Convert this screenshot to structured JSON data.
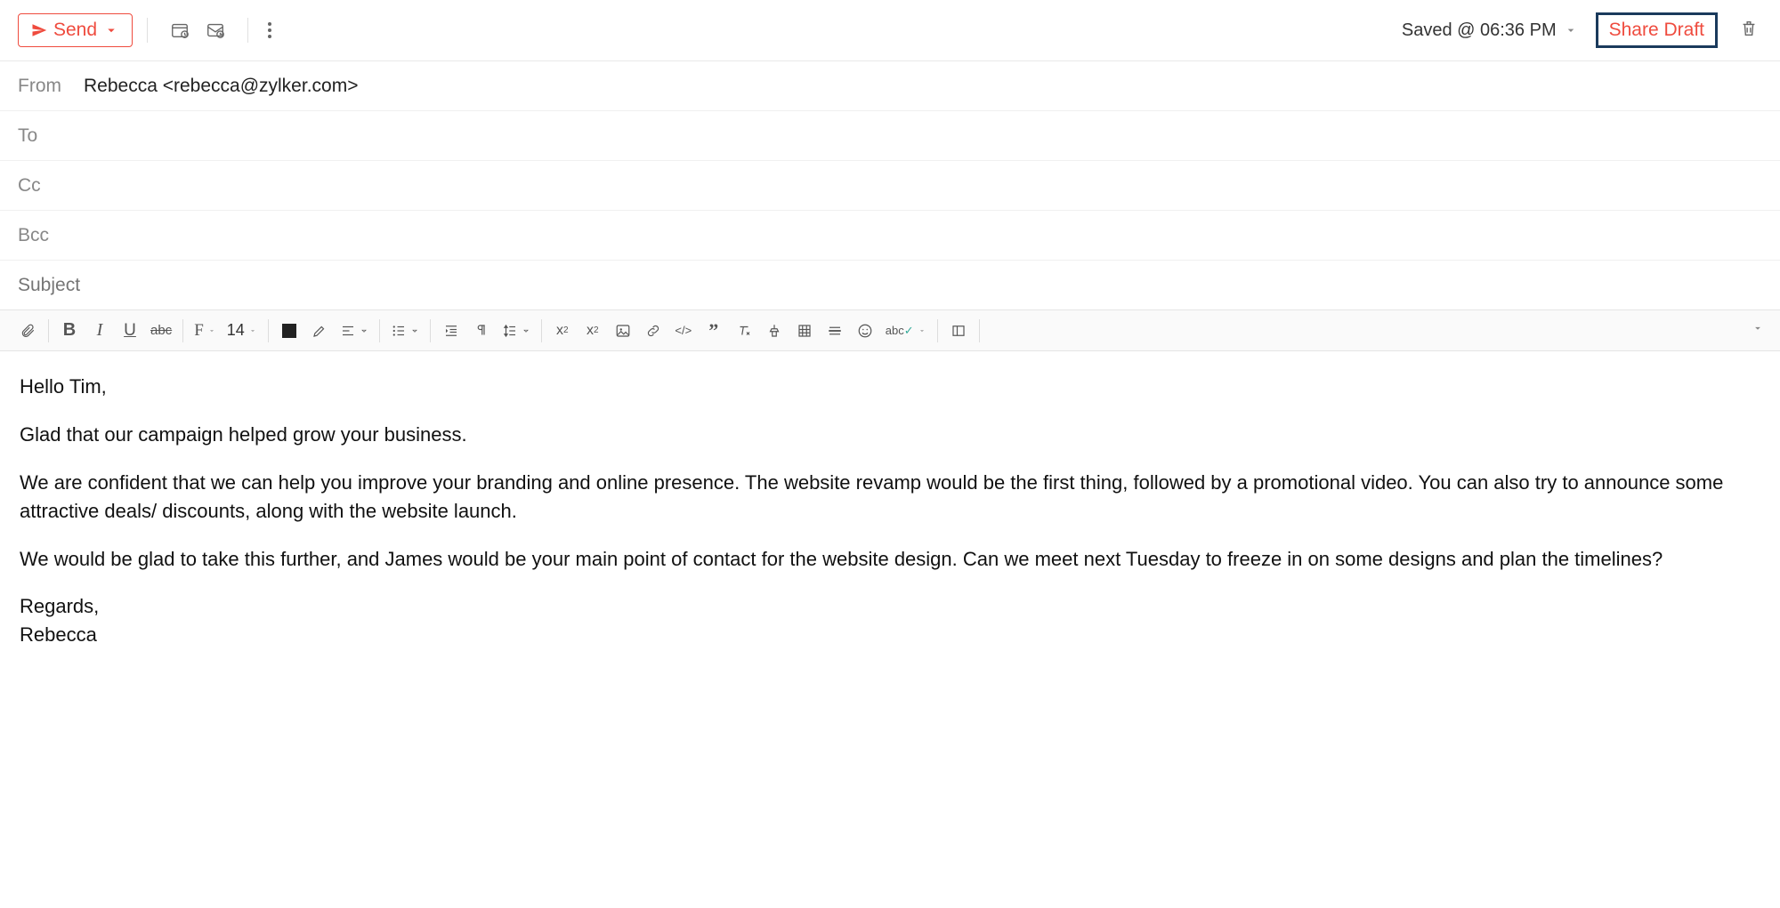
{
  "header": {
    "send_label": "Send",
    "saved_text": "Saved @ 06:36 PM",
    "share_draft_label": "Share Draft"
  },
  "fields": {
    "from_label": "From",
    "from_value": "Rebecca <rebecca@zylker.com>",
    "to_label": "To",
    "to_value": "",
    "cc_label": "Cc",
    "cc_value": "",
    "bcc_label": "Bcc",
    "bcc_value": "",
    "subject_placeholder": "Subject",
    "subject_value": ""
  },
  "formatting": {
    "font_size": "14"
  },
  "body": {
    "greeting": "Hello Tim,",
    "p1": "Glad that our campaign helped grow your business.",
    "p2": "We are confident that we can help you improve your branding and online presence. The website revamp would be the first thing, followed by a promotional video. You can also try to announce some attractive deals/ discounts, along with the website launch.",
    "p3": "We would be glad to take this further, and James would be your main point of contact for the website design. Can we meet next Tuesday to freeze in on some designs and plan the timelines?",
    "sig1": "Regards,",
    "sig2": "Rebecca"
  }
}
